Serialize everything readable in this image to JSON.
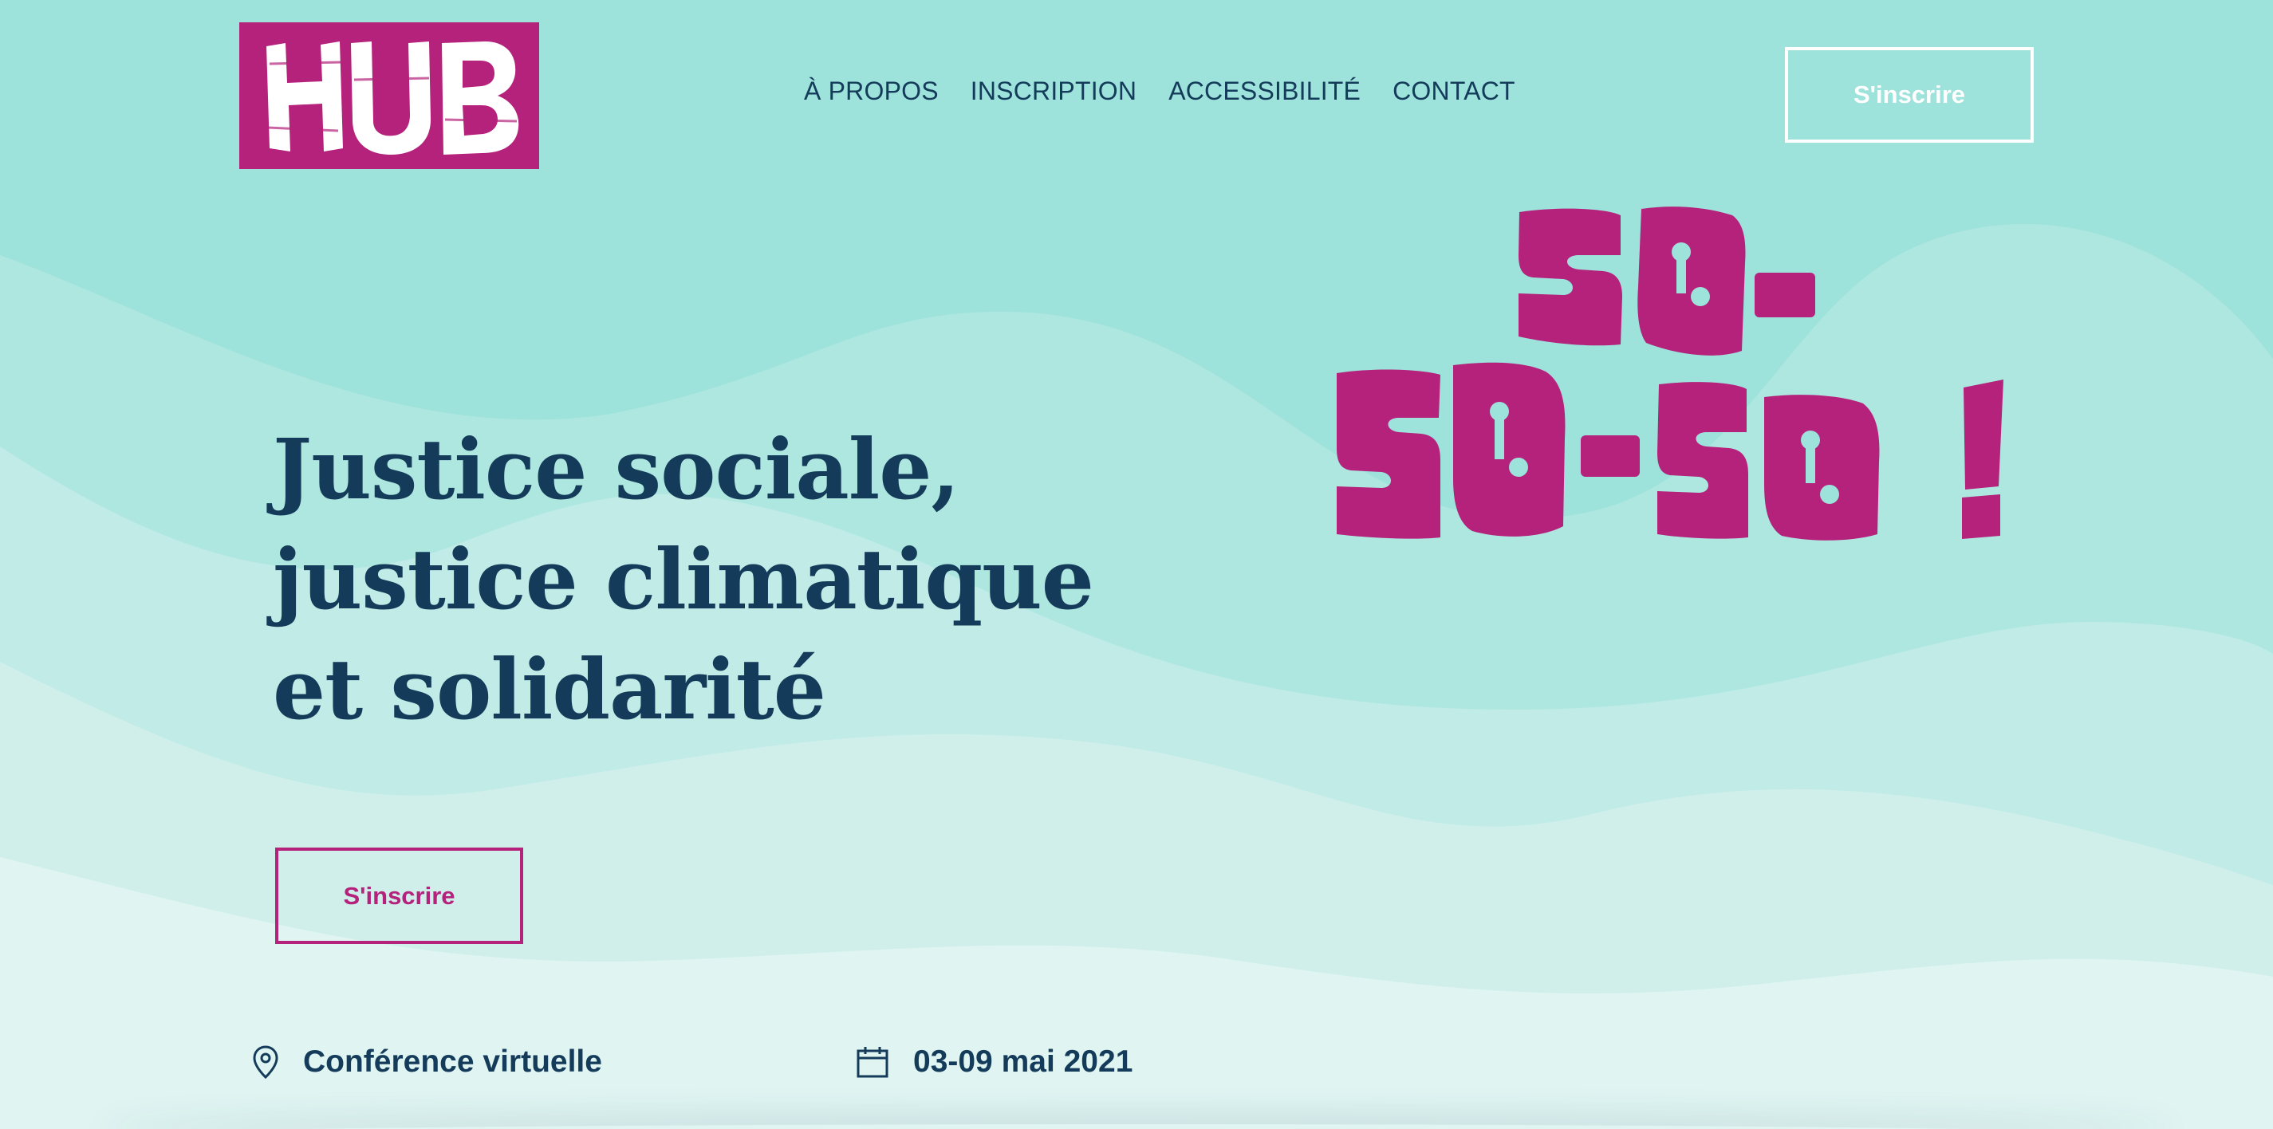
{
  "logo": {
    "text": "HUB",
    "bg_color": "#b5227c",
    "text_color": "#ffffff"
  },
  "nav": {
    "items": [
      {
        "label": "À PROPOS"
      },
      {
        "label": "INSCRIPTION"
      },
      {
        "label": "ACCESSIBILITÉ"
      },
      {
        "label": "CONTACT"
      }
    ]
  },
  "header": {
    "cta_label": "S'inscrire"
  },
  "hero": {
    "slogan": "SO-SO-SO !",
    "title_lines": [
      "Justice sociale,",
      "justice climatique",
      "et solidarité"
    ],
    "cta_label": "S'inscrire"
  },
  "info": {
    "location_icon": "map-pin-icon",
    "location": "Conférence virtuelle",
    "date_icon": "calendar-icon",
    "date": "03-09 mai 2021"
  },
  "colors": {
    "background": "#9de2db",
    "primary_text": "#143c5a",
    "accent": "#b5227c",
    "white": "#ffffff"
  }
}
